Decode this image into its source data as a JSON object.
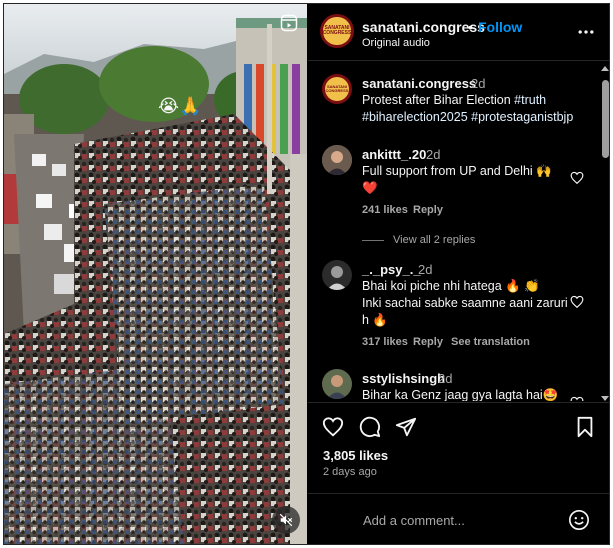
{
  "post": {
    "username": "sanatani.congress",
    "follow_label": "Follow",
    "dot": "•",
    "audio": "Original audio",
    "avatar_text_top": "SANATANI",
    "avatar_text_bottom": "CONGRESS",
    "caption_time": "2d",
    "caption_text": "Protest after Bihar Election",
    "caption_tags": [
      "#truth",
      "#biharelection2025",
      "#protestaganistbjp"
    ],
    "likes": "3,805 likes",
    "date": "2 days ago",
    "add_comment_placeholder": "Add a comment...",
    "video_overlay_emoji": "😭🙏"
  },
  "comments": [
    {
      "username": "ankittt_.20",
      "time": "2d",
      "text": "Full support from UP and Delhi 🙌",
      "text2": "❤️",
      "likes": "241 likes",
      "reply": "Reply",
      "view_replies": "View all 2 replies"
    },
    {
      "username": "_._psy_._",
      "time": "2d",
      "text": "Bhai koi piche nhi hatega 🔥 👏",
      "text2": "Inki sachai sabke saamne aani zaruri",
      "text3": "h 🔥",
      "likes": "317 likes",
      "reply": "Reply",
      "translation": "See translation"
    },
    {
      "username": "sstylishsingh",
      "time": "2d",
      "text": "Bihar ka Genz jaag gya lagta hai🤩"
    }
  ],
  "colors": {
    "accent": "#0095f6",
    "background": "#000000",
    "secondary_text": "#a8a8a8",
    "brand_red": "#7b0e12",
    "brand_gold": "#f1c04a"
  },
  "icons": [
    "reel-icon",
    "mute-icon",
    "more-icon",
    "heart-icon",
    "comment-icon",
    "share-icon",
    "save-icon",
    "smile-icon"
  ]
}
